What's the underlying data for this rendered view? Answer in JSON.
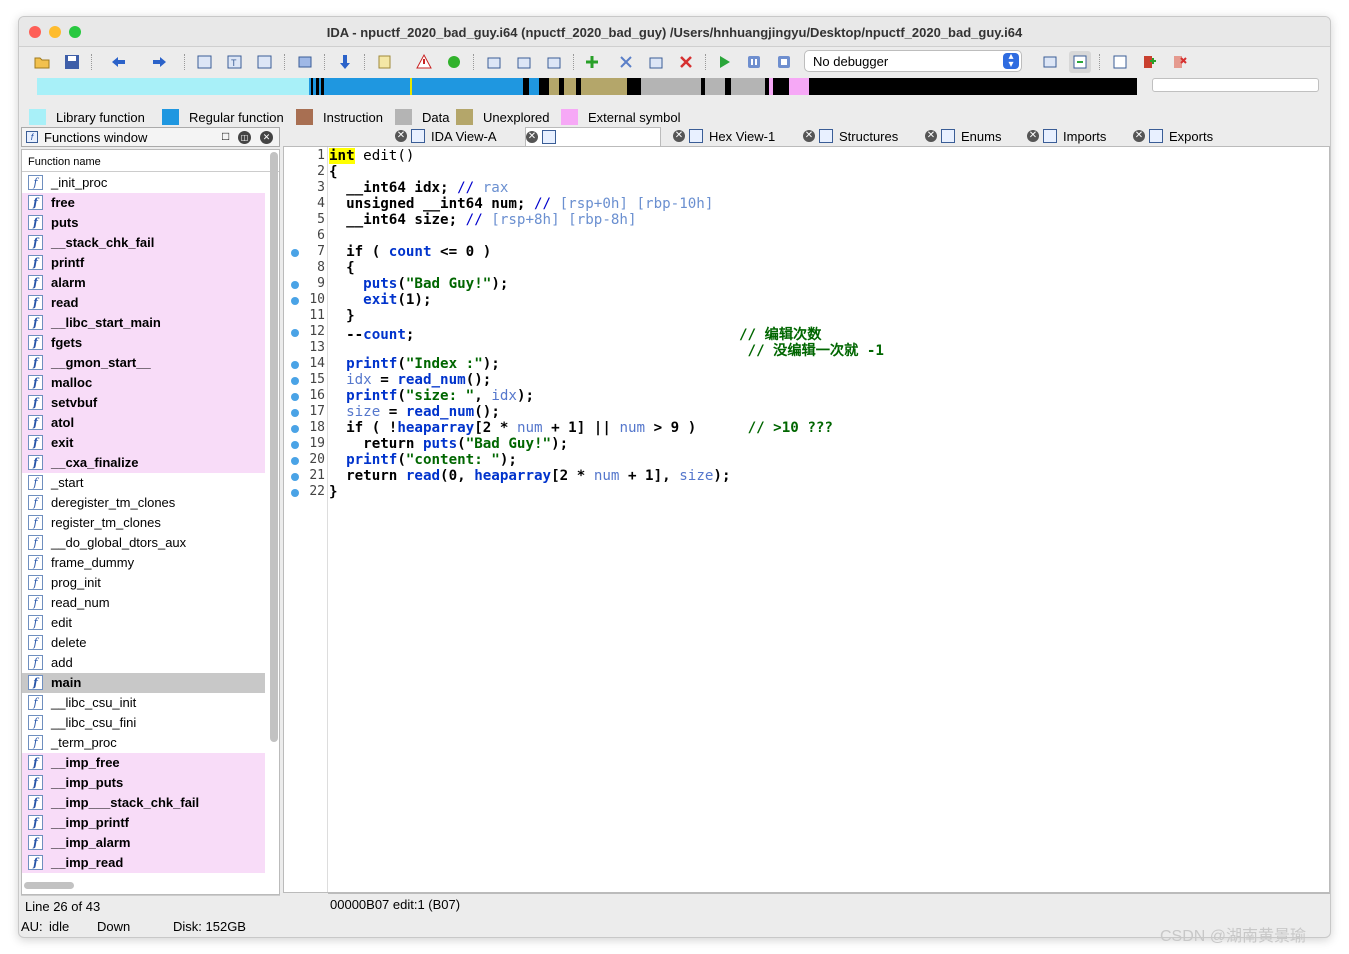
{
  "window": {
    "title": "IDA - npuctf_2020_bad_guy.i64 (npuctf_2020_bad_guy) /Users/hnhuangjingyu/Desktop/npuctf_2020_bad_guy.i64"
  },
  "toolbar": {
    "debugger_select": "No debugger"
  },
  "legend": [
    {
      "label": "Library function",
      "color": "#a8f0f8"
    },
    {
      "label": "Regular function",
      "color": "#1f97e0"
    },
    {
      "label": "Instruction",
      "color": "#a86f52"
    },
    {
      "label": "Data",
      "color": "#b4b4b4"
    },
    {
      "label": "Unexplored",
      "color": "#b4a66a"
    },
    {
      "label": "External symbol",
      "color": "#f6a8f6"
    }
  ],
  "functions_window": {
    "title": "Functions window",
    "column_header": "Function name",
    "items": [
      {
        "name": "_init_proc",
        "kind": "normal"
      },
      {
        "name": "free",
        "kind": "lib"
      },
      {
        "name": "puts",
        "kind": "lib"
      },
      {
        "name": "__stack_chk_fail",
        "kind": "lib"
      },
      {
        "name": "printf",
        "kind": "lib"
      },
      {
        "name": "alarm",
        "kind": "lib"
      },
      {
        "name": "read",
        "kind": "lib"
      },
      {
        "name": "__libc_start_main",
        "kind": "lib"
      },
      {
        "name": "fgets",
        "kind": "lib"
      },
      {
        "name": "__gmon_start__",
        "kind": "lib"
      },
      {
        "name": "malloc",
        "kind": "lib"
      },
      {
        "name": "setvbuf",
        "kind": "lib"
      },
      {
        "name": "atol",
        "kind": "lib"
      },
      {
        "name": "exit",
        "kind": "lib"
      },
      {
        "name": "__cxa_finalize",
        "kind": "lib"
      },
      {
        "name": "_start",
        "kind": "normal"
      },
      {
        "name": "deregister_tm_clones",
        "kind": "normal"
      },
      {
        "name": "register_tm_clones",
        "kind": "normal"
      },
      {
        "name": "__do_global_dtors_aux",
        "kind": "normal"
      },
      {
        "name": "frame_dummy",
        "kind": "normal"
      },
      {
        "name": "prog_init",
        "kind": "normal"
      },
      {
        "name": "read_num",
        "kind": "normal"
      },
      {
        "name": "edit",
        "kind": "normal"
      },
      {
        "name": "delete",
        "kind": "normal"
      },
      {
        "name": "add",
        "kind": "normal"
      },
      {
        "name": "main",
        "kind": "sel"
      },
      {
        "name": "__libc_csu_init",
        "kind": "normal"
      },
      {
        "name": "__libc_csu_fini",
        "kind": "normal"
      },
      {
        "name": "_term_proc",
        "kind": "normal"
      },
      {
        "name": "__imp_free",
        "kind": "lib"
      },
      {
        "name": "__imp_puts",
        "kind": "lib"
      },
      {
        "name": "__imp___stack_chk_fail",
        "kind": "lib"
      },
      {
        "name": "__imp_printf",
        "kind": "lib"
      },
      {
        "name": "__imp_alarm",
        "kind": "lib"
      },
      {
        "name": "__imp_read",
        "kind": "lib"
      }
    ],
    "line_status": "Line 26 of 43"
  },
  "tabs": [
    {
      "label": "IDA View-A"
    },
    {
      "label": ""
    },
    {
      "label": "Hex View-1"
    },
    {
      "label": "Structures"
    },
    {
      "label": "Enums"
    },
    {
      "label": "Imports"
    },
    {
      "label": "Exports"
    }
  ],
  "code": {
    "lines": [
      {
        "n": "1",
        "bp": false,
        "html": "<span class='hl'>int</span> <span style='font-weight:normal'>edit()</span>"
      },
      {
        "n": "2",
        "bp": false,
        "html": "{"
      },
      {
        "n": "3",
        "bp": false,
        "html": "  __int64 idx; <span class='cm'>// </span><span class='cmg'>rax</span>"
      },
      {
        "n": "4",
        "bp": false,
        "html": "  unsigned __int64 num; <span class='cm'>// </span><span class='cmg'>[rsp+0h] [rbp-10h]</span>"
      },
      {
        "n": "5",
        "bp": false,
        "html": "  __int64 size; <span class='cm'>// </span><span class='cmg'>[rsp+8h] [rbp-8h]</span>"
      },
      {
        "n": "6",
        "bp": false,
        "html": ""
      },
      {
        "n": "7",
        "bp": true,
        "html": "  if ( <span class='fnc'>count</span> &lt;= 0 )"
      },
      {
        "n": "8",
        "bp": false,
        "html": "  {"
      },
      {
        "n": "9",
        "bp": true,
        "html": "    <span class='fnc'>puts</span>(<span class='str'>\"Bad Guy!\"</span>);"
      },
      {
        "n": "10",
        "bp": true,
        "html": "    <span class='fnc'>exit</span>(1);"
      },
      {
        "n": "11",
        "bp": false,
        "html": "  }"
      },
      {
        "n": "12",
        "bp": true,
        "html": "  --<span class='fnc'>count</span>;                                      <span class='cmc'>// 编辑次数</span>"
      },
      {
        "n": "13",
        "bp": false,
        "html": "                                                 <span class='cmc'>// 没编辑一次就 -1</span>"
      },
      {
        "n": "14",
        "bp": true,
        "html": "  <span class='fnc'>printf</span>(<span class='str'>\"Index :\"</span>);"
      },
      {
        "n": "15",
        "bp": true,
        "html": "  <span class='var'>idx</span> = <span class='fnc'>read_num</span>();"
      },
      {
        "n": "16",
        "bp": true,
        "html": "  <span class='fnc'>printf</span>(<span class='str'>\"size: \"</span>, <span class='var'>idx</span>);"
      },
      {
        "n": "17",
        "bp": true,
        "html": "  <span class='var'>size</span> = <span class='fnc'>read_num</span>();"
      },
      {
        "n": "18",
        "bp": true,
        "html": "  if ( !<span class='fnc'>heaparray</span>[2 * <span class='var'>num</span> + 1] || <span class='var'>num</span> &gt; 9 )      <span class='cmc'>// &gt;10 ???</span>"
      },
      {
        "n": "19",
        "bp": true,
        "html": "    return <span class='fnc'>puts</span>(<span class='str'>\"Bad Guy!\"</span>);"
      },
      {
        "n": "20",
        "bp": true,
        "html": "  <span class='fnc'>printf</span>(<span class='str'>\"content: \"</span>);"
      },
      {
        "n": "21",
        "bp": true,
        "html": "  return <span class='fnc'>read</span>(0, <span class='fnc'>heaparray</span>[2 * <span class='var'>num</span> + 1], <span class='var'>size</span>);"
      },
      {
        "n": "22",
        "bp": true,
        "html": "}"
      }
    ],
    "address_status": "00000B07  edit:1 (B07)"
  },
  "status": {
    "au": "AU:",
    "state": "idle",
    "direction": "Down",
    "disk": "Disk: 152GB"
  },
  "watermark": "CSDN @湖南黄景瑜"
}
